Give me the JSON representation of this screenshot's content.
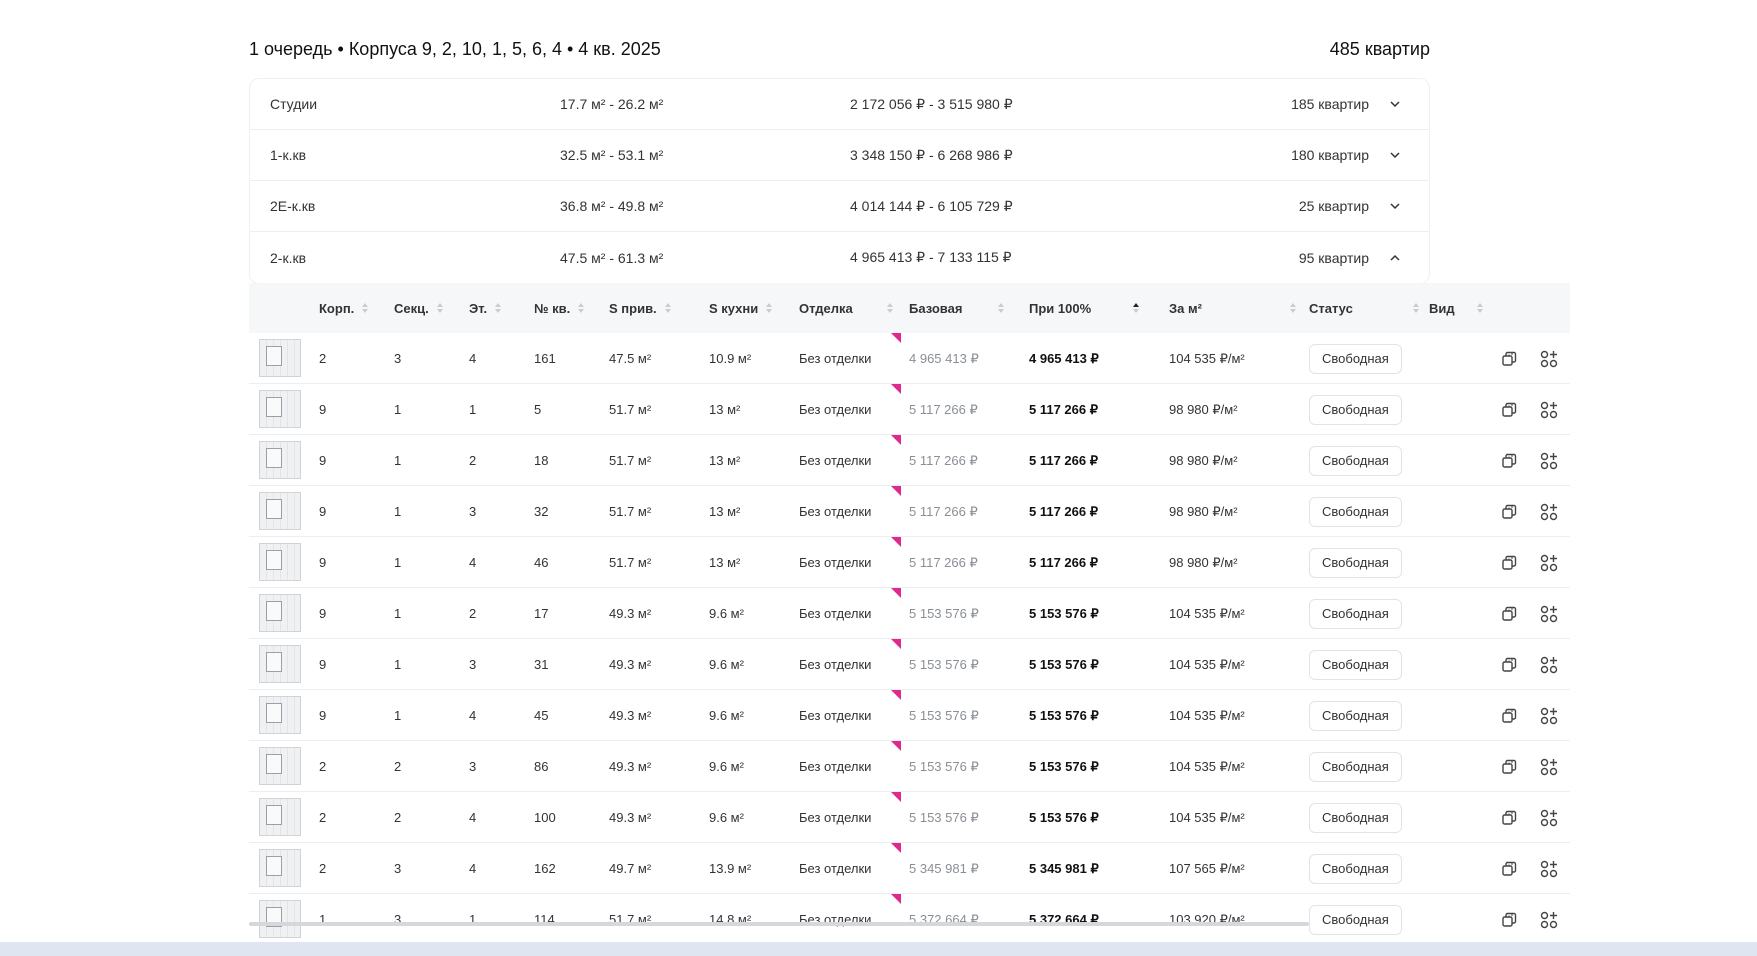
{
  "queue": {
    "title": "1 очередь • Корпуса 9, 2, 10, 1, 5, 6, 4 • 4 кв. 2025",
    "count": "485 квартир"
  },
  "groups": [
    {
      "name": "Студии",
      "area": "17.7 м² - 26.2 м²",
      "price": "2 172 056 ₽ - 3 515 980 ₽",
      "count": "185 квартир",
      "expanded": false
    },
    {
      "name": "1-к.кв",
      "area": "32.5 м² - 53.1 м²",
      "price": "3 348 150 ₽ - 6 268 986 ₽",
      "count": "180 квартир",
      "expanded": false
    },
    {
      "name": "2Е-к.кв",
      "area": "36.8 м² - 49.8 м²",
      "price": "4 014 144 ₽ - 6 105 729 ₽",
      "count": "25 квартир",
      "expanded": false
    },
    {
      "name": "2-к.кв",
      "area": "47.5 м² - 61.3 м²",
      "price": "4 965 413 ₽ - 7 133 115 ₽",
      "count": "95 квартир",
      "expanded": true
    }
  ],
  "table": {
    "headers": {
      "korp": "Корп.",
      "sekc": "Секц.",
      "et": "Эт.",
      "num": "№ кв.",
      "s_priv": "S прив.",
      "s_kuh": "S кухни",
      "otdelka": "Отделка",
      "base": "Базовая",
      "full": "При 100%",
      "per_m": "За м²",
      "status": "Статус",
      "vid": "Вид"
    },
    "rows": [
      {
        "korp": "2",
        "sekc": "3",
        "et": "4",
        "num": "161",
        "s_priv": "47.5 м²",
        "s_kuh": "10.9 м²",
        "otdelka": "Без отделки",
        "base": "4 965 413 ₽",
        "full": "4 965 413 ₽",
        "per_m": "104 535 ₽/м²",
        "status": "Свободная"
      },
      {
        "korp": "9",
        "sekc": "1",
        "et": "1",
        "num": "5",
        "s_priv": "51.7 м²",
        "s_kuh": "13 м²",
        "otdelka": "Без отделки",
        "base": "5 117 266 ₽",
        "full": "5 117 266 ₽",
        "per_m": "98 980 ₽/м²",
        "status": "Свободная"
      },
      {
        "korp": "9",
        "sekc": "1",
        "et": "2",
        "num": "18",
        "s_priv": "51.7 м²",
        "s_kuh": "13 м²",
        "otdelka": "Без отделки",
        "base": "5 117 266 ₽",
        "full": "5 117 266 ₽",
        "per_m": "98 980 ₽/м²",
        "status": "Свободная"
      },
      {
        "korp": "9",
        "sekc": "1",
        "et": "3",
        "num": "32",
        "s_priv": "51.7 м²",
        "s_kuh": "13 м²",
        "otdelka": "Без отделки",
        "base": "5 117 266 ₽",
        "full": "5 117 266 ₽",
        "per_m": "98 980 ₽/м²",
        "status": "Свободная"
      },
      {
        "korp": "9",
        "sekc": "1",
        "et": "4",
        "num": "46",
        "s_priv": "51.7 м²",
        "s_kuh": "13 м²",
        "otdelka": "Без отделки",
        "base": "5 117 266 ₽",
        "full": "5 117 266 ₽",
        "per_m": "98 980 ₽/м²",
        "status": "Свободная"
      },
      {
        "korp": "9",
        "sekc": "1",
        "et": "2",
        "num": "17",
        "s_priv": "49.3 м²",
        "s_kuh": "9.6 м²",
        "otdelka": "Без отделки",
        "base": "5 153 576 ₽",
        "full": "5 153 576 ₽",
        "per_m": "104 535 ₽/м²",
        "status": "Свободная"
      },
      {
        "korp": "9",
        "sekc": "1",
        "et": "3",
        "num": "31",
        "s_priv": "49.3 м²",
        "s_kuh": "9.6 м²",
        "otdelka": "Без отделки",
        "base": "5 153 576 ₽",
        "full": "5 153 576 ₽",
        "per_m": "104 535 ₽/м²",
        "status": "Свободная"
      },
      {
        "korp": "9",
        "sekc": "1",
        "et": "4",
        "num": "45",
        "s_priv": "49.3 м²",
        "s_kuh": "9.6 м²",
        "otdelka": "Без отделки",
        "base": "5 153 576 ₽",
        "full": "5 153 576 ₽",
        "per_m": "104 535 ₽/м²",
        "status": "Свободная"
      },
      {
        "korp": "2",
        "sekc": "2",
        "et": "3",
        "num": "86",
        "s_priv": "49.3 м²",
        "s_kuh": "9.6 м²",
        "otdelka": "Без отделки",
        "base": "5 153 576 ₽",
        "full": "5 153 576 ₽",
        "per_m": "104 535 ₽/м²",
        "status": "Свободная"
      },
      {
        "korp": "2",
        "sekc": "2",
        "et": "4",
        "num": "100",
        "s_priv": "49.3 м²",
        "s_kuh": "9.6 м²",
        "otdelka": "Без отделки",
        "base": "5 153 576 ₽",
        "full": "5 153 576 ₽",
        "per_m": "104 535 ₽/м²",
        "status": "Свободная"
      },
      {
        "korp": "2",
        "sekc": "3",
        "et": "4",
        "num": "162",
        "s_priv": "49.7 м²",
        "s_kuh": "13.9 м²",
        "otdelka": "Без отделки",
        "base": "5 345 981 ₽",
        "full": "5 345 981 ₽",
        "per_m": "107 565 ₽/м²",
        "status": "Свободная"
      },
      {
        "korp": "1",
        "sekc": "3",
        "et": "1",
        "num": "114",
        "s_priv": "51.7 м²",
        "s_kuh": "14.8 м²",
        "otdelka": "Без отделки",
        "base": "5 372 664 ₽",
        "full": "5 372 664 ₽",
        "per_m": "103 920 ₽/м²",
        "status": "Свободная"
      }
    ]
  },
  "colors": {
    "discount_marker": "#e0298f",
    "header_bg": "#f6f7f9"
  },
  "icons": {
    "compare": "compare-icon",
    "add_to_list": "add-shapes-icon",
    "chevron_down": "chevron-down-icon",
    "chevron_up": "chevron-up-icon"
  }
}
